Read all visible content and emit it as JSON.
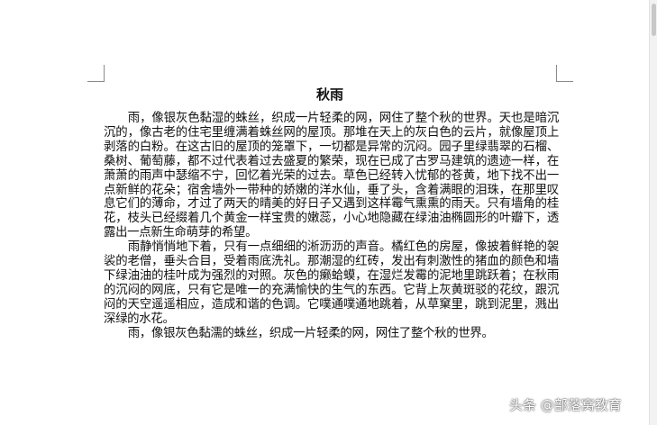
{
  "document": {
    "title": "秋雨",
    "paragraphs": [
      "雨，像银灰色黏湿的蛛丝，织成一片轻柔的网，网住了整个秋的世界。天也是暗沉沉的，像古老的住宅里缠满着蛛丝网的屋顶。那堆在天上的灰白色的云片，就像屋顶上剥落的白粉。在这古旧的屋顶的笼罩下，一切都是异常的沉闷。园子里绿翡翠的石榴、桑树、葡萄藤，都不过代表着过去盛夏的繁荣，现在已成了古罗马建筑的遗迹一样，在萧萧的雨声中瑟缩不宁，回忆着光荣的过去。草色已经转入忧郁的苍黄，地下找不出一点新鲜的花朵；宿舍墙外一带种的娇嫩的洋水仙，垂了头，含着满眼的泪珠，在那里叹息它们的薄命，才过了两天的晴美的好日子又遇到这样霉气熏熏的雨天。只有墙角的桂花，枝头已经缀着几个黄金一样宝贵的嫩蕊，小心地隐藏在绿油油椭圆形的叶瓣下，透露出一点新生命萌芽的希望。",
      "雨静悄悄地下着，只有一点细细的淅沥沥的声音。橘红色的房屋，像披着鲜艳的袈裟的老僧，垂头合目，受着雨底洗礼。那潮湿的红砖，发出有刺激性的猪血的颜色和墙下绿油油的桂叶成为强烈的对照。灰色的癞蛤蟆，在湿烂发霉的泥地里跳跃着；在秋雨的沉闷的网底，只有它是唯一的充满愉快的生气的东西。它背上灰黄斑驳的花纹，跟沉闷的天空遥遥相应，造成和谐的色调。它噗通噗通地跳着，从草窠里，跳到泥里，溅出深绿的水花。",
      "雨，像银灰色黏濡的蛛丝，织成一片轻柔的网，网住了整个秋的世界。"
    ]
  },
  "watermark": "头条 @部落窝教育"
}
